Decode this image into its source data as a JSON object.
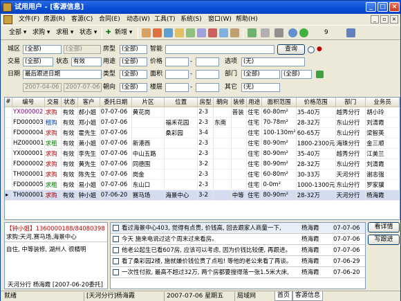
{
  "window": {
    "title": "试用用户 - [客源信息]"
  },
  "menu": [
    "文件(F)",
    "房源(R)",
    "客源(C)",
    "合同(E)",
    "动态(W)",
    "工具(T)",
    "系统(S)",
    "窗口(W)",
    "帮助(H)"
  ],
  "toolbar": {
    "all": "全部",
    "buy": "求购",
    "rent": "求租",
    "status": "状态",
    "add": "新增",
    "page": "9"
  },
  "filter": {
    "region_label": "城区",
    "region_value": "(全部)",
    "region2_value": "(全部)",
    "house_type_label": "房型",
    "house_type_value": "(全部)",
    "smart_label": "智能",
    "query_btn": "查询",
    "trade_label": "交易",
    "trade_value": "(全部)",
    "status_label": "状态",
    "status_value": "有效",
    "usage_label": "用途",
    "usage_value": "(全部)",
    "price_label": "价格",
    "option_label": "选项",
    "option_value": "(无)",
    "date_label": "日期",
    "date_value": "最后跟进日期",
    "type_label": "类型",
    "type_value": "(全部)",
    "area_label": "面积",
    "dept_label": "部门",
    "dept_value": "(全部)",
    "dept2_value": "(全部)",
    "date_from": "2007-04-06",
    "date_to": "2007-07-06",
    "orient_label": "朝向",
    "orient_value": "(全部)",
    "floor_label": "楼层",
    "other_label": "其它",
    "other_value": "(无)"
  },
  "table": {
    "columns": [
      "#",
      "编号",
      "交易",
      "状态",
      "客户",
      "委托日期",
      "片区",
      "位置",
      "房型",
      "朝向",
      "装修",
      "用途",
      "面积范围",
      "价格范围",
      "部门",
      "业务员"
    ],
    "rows": [
      [
        "",
        "YX000002",
        "求购",
        "有效",
        "郝小姐",
        "07-07-06",
        "黄花岗",
        "",
        "2-3",
        "",
        "普装",
        "住宅",
        "60-80m²",
        "35-40万",
        "越秀分行",
        "胡小玲"
      ],
      [
        "",
        "FD000003",
        "租购",
        "有效",
        "郑小姐",
        "07-07-06",
        "",
        "福禾花园",
        "2-3",
        "东南",
        "",
        "住宅",
        "70-78m²",
        "28-32万",
        "东山分行",
        "刘清霞"
      ],
      [
        "",
        "FD000004",
        "求购",
        "有效",
        "霍先生",
        "07-07-06",
        "",
        "桑彩园",
        "3-4",
        "",
        "",
        "住宅",
        "100-130m²",
        "60-65万",
        "东山分行",
        "梁智英"
      ],
      [
        "",
        "HZ000001",
        "求租",
        "有效",
        "萧小姐",
        "07-07-06",
        "新港西",
        "",
        "2-3",
        "",
        "",
        "住宅",
        "80-90m²",
        "1800-2300元",
        "海珠分行",
        "金三顺"
      ],
      [
        "",
        "YX000001",
        "求购",
        "有效",
        "李先生",
        "07-07-06",
        "中山五路",
        "",
        "2-3",
        "",
        "",
        "住宅",
        "80-90m²",
        "35-40万",
        "越秀分行",
        "江美兰"
      ],
      [
        "",
        "FD000002",
        "求购",
        "有效",
        "黄先生",
        "07-07-06",
        "同德围",
        "",
        "3-2",
        "",
        "",
        "住宅",
        "80-90m²",
        "28-32万",
        "东山分行",
        "刘清霞"
      ],
      [
        "",
        "TH000001",
        "求购",
        "有效",
        "陈先生",
        "07-07-06",
        "岗金",
        "",
        "2-3",
        "",
        "",
        "住宅",
        "60-80m²",
        "30-33万",
        "天河分行",
        "谢志强"
      ],
      [
        "",
        "FD000005",
        "求租",
        "有效",
        "易小姐",
        "07-07-06",
        "东山口",
        "",
        "2-3",
        "",
        "",
        "住宅",
        "0-0m²",
        "1000-1300元",
        "东山分行",
        "罗家骥"
      ],
      [
        "",
        "TH000001",
        "求购",
        "有效",
        "钟小姐",
        "07-06-20",
        "赛马场",
        "海景中心",
        "3-2",
        "",
        "中等",
        "住宅",
        "80-90m²",
        "28-32万",
        "天河分行",
        "杨海霞"
      ]
    ]
  },
  "client": {
    "name": "【钟小姐】",
    "phone": "1360000188/84080398",
    "demand": "求购:天河,赛马场,海景中心",
    "notes": "自住, 中等装修, 湖州人  很精明",
    "footer": "天河分行  杨海霞  [2007-06-20委托]"
  },
  "followups": [
    {
      "text": "看过海景中心403, 觉得有点贵, 价钱高, 回去跟家人商量一下,",
      "agent": "杨海霞",
      "date": "07-07-06"
    },
    {
      "text": "今天 施来电说过这个周末过来看房。",
      "agent": "杨海霞",
      "date": "07-07-06"
    },
    {
      "text": "他老公起生已看607房, 应该可以考虑, 因为价钱比较便, 再跟进。",
      "agent": "杨海霞",
      "date": "07-07-06"
    },
    {
      "text": "看了桑彩园2楼, 施就嫌价钱位贵了点啦! 等他的老公来看了再谈。",
      "agent": "杨海霞",
      "date": "07-06-29"
    },
    {
      "text": "一次性付款, 最高不超过32万, 两个房都要搜得落一张1.5米大床,",
      "agent": "杨海霞",
      "date": "07-06-20"
    }
  ],
  "side_buttons": {
    "view": "看详情",
    "write": "写跟进"
  },
  "status": {
    "ready": "就绪",
    "branch_user": "[天河分行]杨海霞",
    "date": "2007-07-06 星期五",
    "network": "局域网",
    "tab_home": "首页",
    "tab_client": "客源信息"
  },
  "colors": {
    "title": "#0A4ED6",
    "buy": "#C00000",
    "rent": "#008000",
    "code": "#800080"
  }
}
